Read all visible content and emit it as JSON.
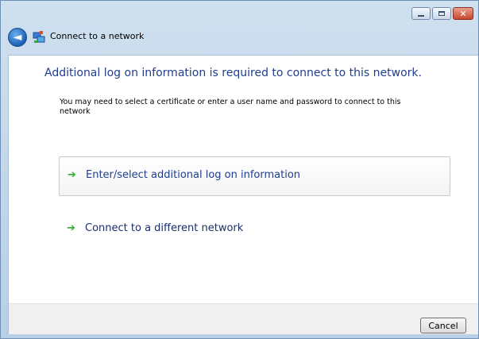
{
  "window": {
    "title": "Connect to a network",
    "icons": {
      "back": "back-arrow-icon",
      "network": "network-icon",
      "minimize": "minimize-icon",
      "maximize": "maximize-icon",
      "close": "close-icon"
    }
  },
  "main": {
    "heading": "Additional log on information is required to connect to this network.",
    "description": "You may need to select a certificate or enter a user name and password to connect to this network",
    "options": [
      {
        "label": "Enter/select additional log on information",
        "icon": "green-arrow-icon"
      },
      {
        "label": "Connect to a different network",
        "icon": "green-arrow-icon"
      }
    ]
  },
  "footer": {
    "cancel_label": "Cancel"
  },
  "colors": {
    "heading": "#1f3e8c",
    "arrow": "#2bb12b",
    "close_button": "#c9452b",
    "title_bar": "#b8cfe6"
  }
}
